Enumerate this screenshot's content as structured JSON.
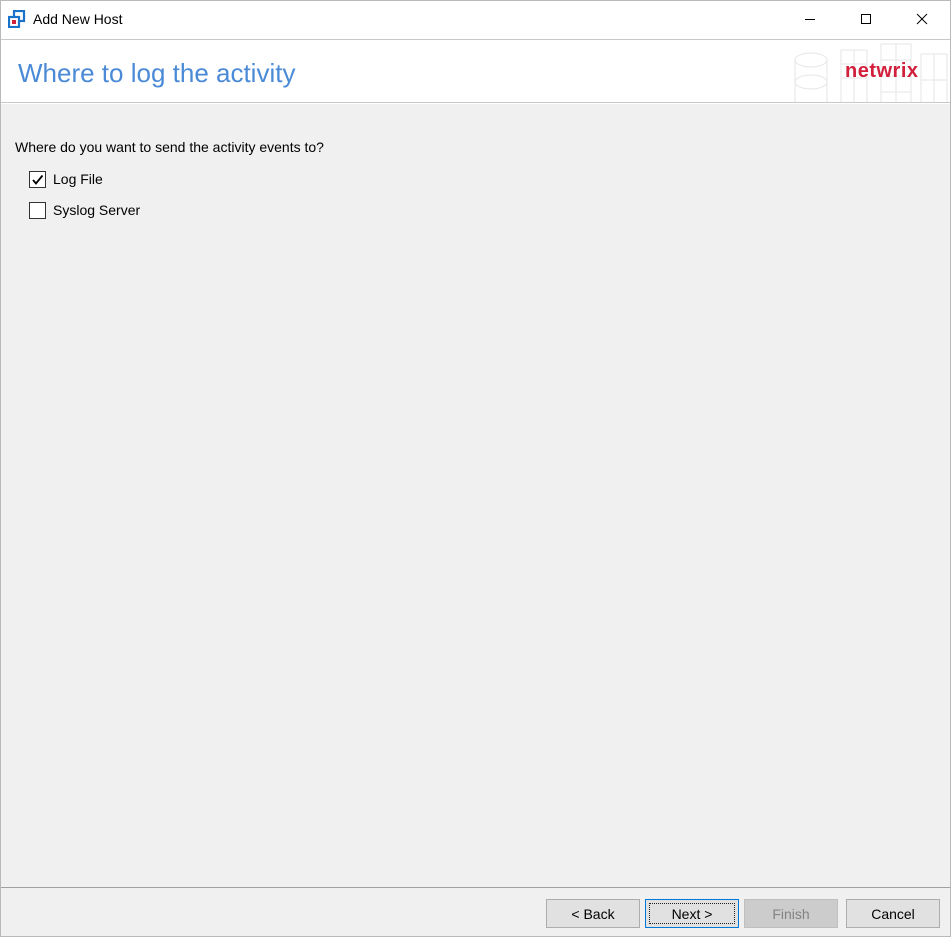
{
  "window": {
    "title": "Add New Host"
  },
  "header": {
    "title": "Where to log the activity",
    "brand": "netwrix"
  },
  "content": {
    "prompt": "Where do you want to send the activity events to?",
    "options": [
      {
        "label": "Log File",
        "checked": true
      },
      {
        "label": "Syslog Server",
        "checked": false
      }
    ]
  },
  "footer": {
    "back_label": "< Back",
    "next_label": "Next >",
    "finish_label": "Finish",
    "cancel_label": "Cancel",
    "finish_enabled": false
  },
  "colors": {
    "header_title": "#4a8ad6",
    "brand": "#d21f3c",
    "content_bg": "#f0f0f0",
    "focus_border": "#0078d7"
  },
  "icons": {
    "app": "app-window-icon",
    "minimize": "minimize-icon",
    "maximize": "maximize-icon",
    "close": "close-icon",
    "check": "checkmark-icon"
  }
}
